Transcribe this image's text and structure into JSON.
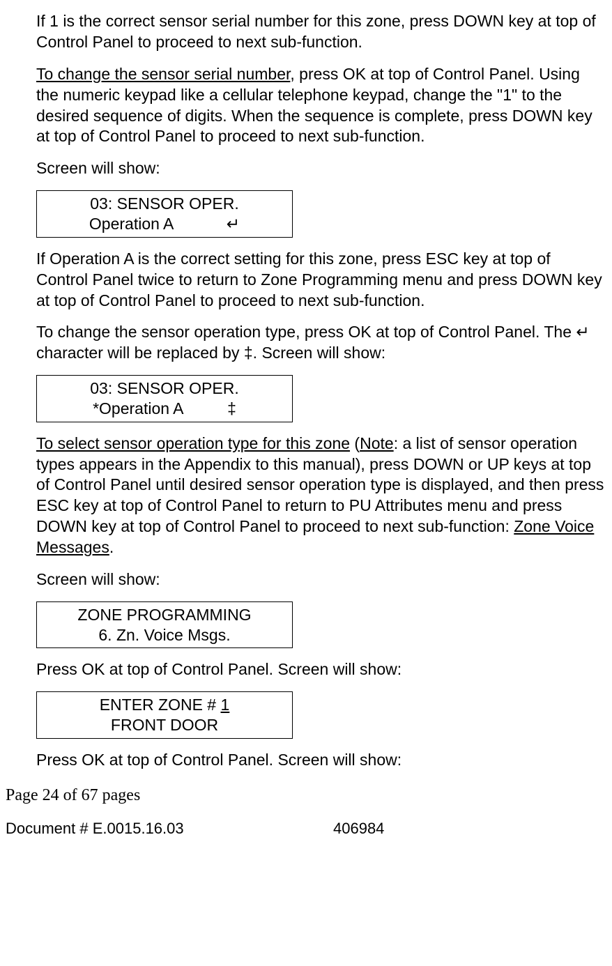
{
  "para1": "If 1 is the correct sensor serial number for this zone, press DOWN key at top of Control Panel to proceed to next sub-function.",
  "para2_u": "To change the sensor serial number",
  "para2_rest": ", press OK at top of Control Panel. Using the numeric keypad like a cellular telephone keypad, change the \"1\" to the desired sequence of digits. When the sequence is complete, press DOWN key at top of Control Panel to proceed to next sub-function.",
  "para3": "Screen will show:",
  "lcd1_line1": "03: SENSOR OPER.",
  "lcd1_line2": "Operation A            ↵",
  "para4": "If Operation A is the correct setting for this zone, press ESC key at top of Control Panel twice to return to Zone Programming menu and press DOWN key at top of Control Panel to proceed to next sub-function.",
  "para5": "To change the sensor operation type, press OK at top of Control Panel. The ↵ character will be replaced by ‡. Screen will show:",
  "lcd2_line1": "03: SENSOR OPER.",
  "lcd2_line2": "*Operation A          ‡",
  "para6_u1": "To select sensor operation type for this zone",
  "para6_sep": " (",
  "para6_u2": "Note",
  "para6_mid": ": a list of sensor operation types appears in the Appendix to this manual), press DOWN or UP keys at top of Control Panel until desired sensor operation type is displayed, and then press ESC key at top of Control Panel to return to PU Attributes menu and press DOWN key at top of Control Panel to proceed to next sub-function: ",
  "para6_u3": "Zone Voice Messages",
  "para6_end": ".",
  "para7": "Screen will show:",
  "lcd3_line1": "ZONE PROGRAMMING",
  "lcd3_line2": "6. Zn. Voice Msgs.",
  "para8": "Press OK at top of Control Panel. Screen will show:",
  "lcd4_line1_pre": "ENTER ZONE # ",
  "lcd4_line1_u": "1",
  "lcd4_line2": "FRONT DOOR",
  "para9": "Press OK at top of Control Panel. Screen will show:",
  "footer_page": "Page 24 of  67 pages",
  "footer_doc": "Document # E.0015.16.03",
  "footer_num": "406984"
}
